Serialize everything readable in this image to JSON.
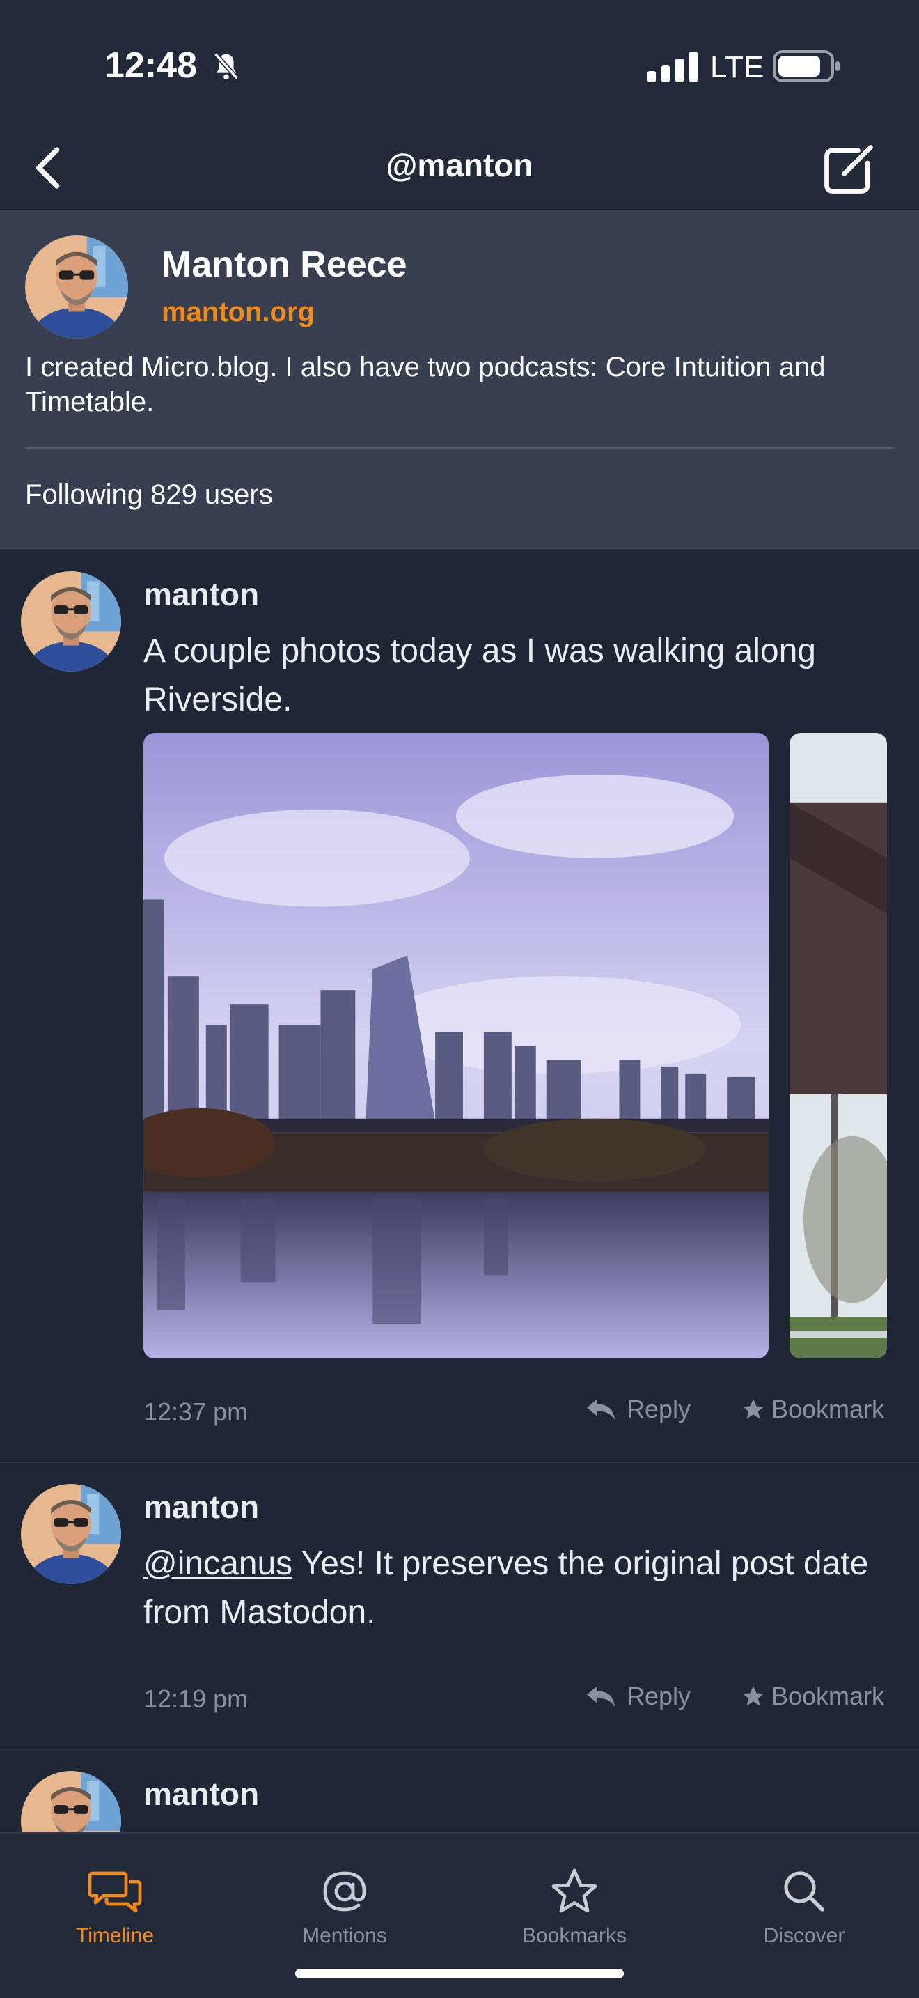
{
  "status_bar": {
    "time": "12:48",
    "network": "LTE"
  },
  "nav": {
    "title": "@manton"
  },
  "profile": {
    "name": "Manton Reece",
    "url": "manton.org",
    "bio": "I created Micro.blog. I also have two podcasts: Core Intuition and Timetable.",
    "following": "Following 829 users"
  },
  "posts": [
    {
      "author": "manton",
      "text": "A couple photos today as I was walking along Riverside.",
      "time": "12:37 pm",
      "reply_label": "Reply",
      "bookmark_label": "Bookmark"
    },
    {
      "author": "manton",
      "mention": "@incanus",
      "text": " Yes! It preserves the original post date from Mastodon.",
      "time": "12:19 pm",
      "reply_label": "Reply",
      "bookmark_label": "Bookmark"
    },
    {
      "author": "manton"
    }
  ],
  "tabs": [
    {
      "label": "Timeline",
      "icon": "chat-bubbles-icon",
      "active": true
    },
    {
      "label": "Mentions",
      "icon": "at-icon",
      "active": false
    },
    {
      "label": "Bookmarks",
      "icon": "star-icon",
      "active": false
    },
    {
      "label": "Discover",
      "icon": "search-icon",
      "active": false
    }
  ],
  "colors": {
    "accent": "#f08a1c",
    "background": "#1f2635",
    "header": "#373f50",
    "muted": "#8a909c"
  }
}
